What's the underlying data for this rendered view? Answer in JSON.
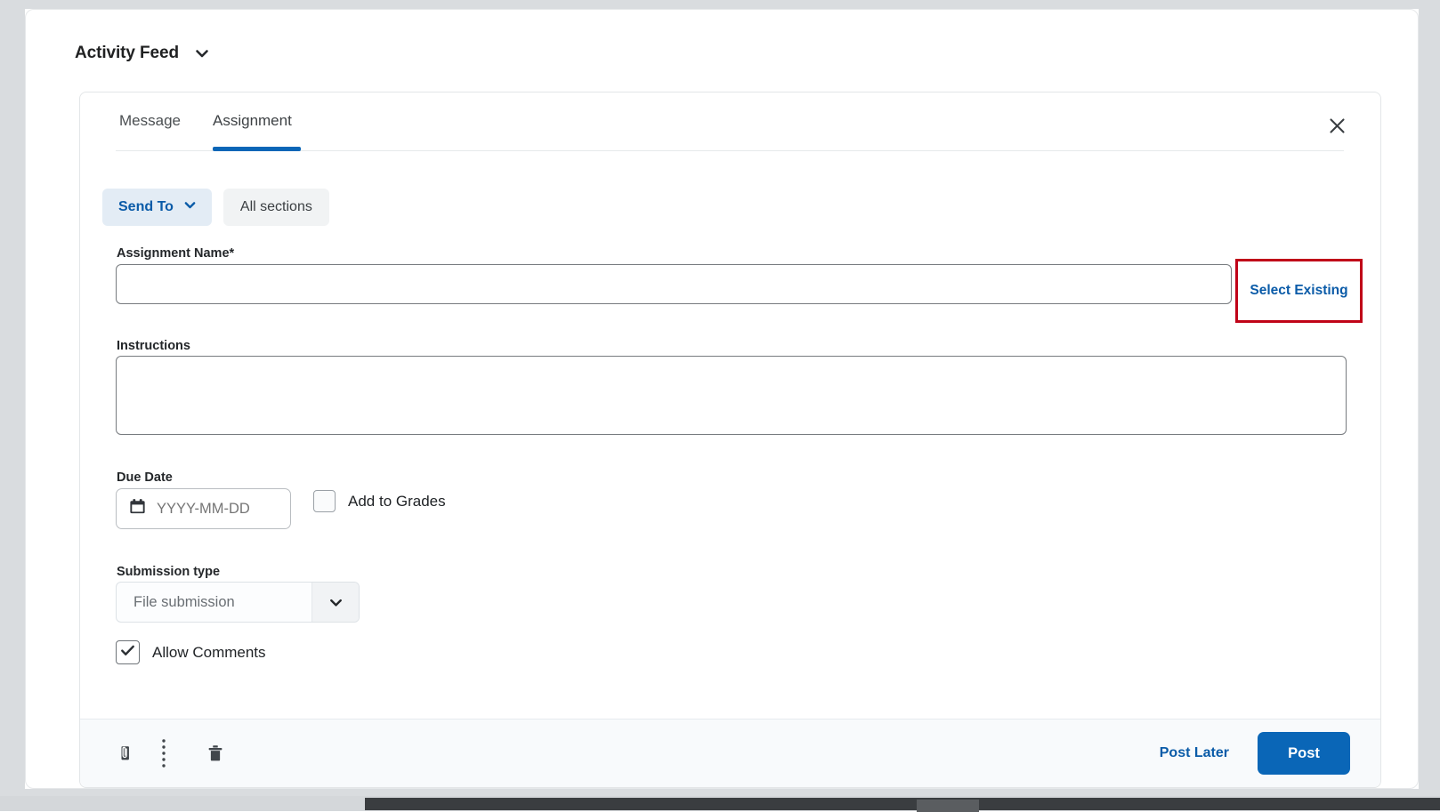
{
  "feed": {
    "title": "Activity Feed",
    "caret_icon": "chevron-down-icon"
  },
  "composer": {
    "tabs": [
      {
        "label": "Message",
        "active": false
      },
      {
        "label": "Assignment",
        "active": true
      }
    ],
    "close_icon": "close-icon",
    "send_to": {
      "label": "Send To",
      "caret_icon": "chevron-down-icon"
    },
    "all_sections_label": "All sections",
    "assignment_name": {
      "label": "Assignment Name",
      "required_marker": "*",
      "value": "",
      "placeholder": ""
    },
    "select_existing": {
      "label": "Select Existing",
      "highlight_color": "#c00418"
    },
    "instructions": {
      "label": "Instructions",
      "value": "",
      "placeholder": ""
    },
    "due_date": {
      "label": "Due Date",
      "calendar_icon": "calendar-icon",
      "value": "",
      "placeholder": "YYYY-MM-DD"
    },
    "add_to_grades": {
      "label": "Add to Grades",
      "checked": false
    },
    "submission_type": {
      "label": "Submission type",
      "selected": "File submission",
      "caret_icon": "chevron-down-icon"
    },
    "allow_comments": {
      "label": "Allow Comments",
      "checked": true,
      "check_icon": "check-icon"
    },
    "footer": {
      "attach_icon": "paperclip-icon",
      "more_icon": "kebab-menu-icon",
      "delete_icon": "trash-icon",
      "post_later_label": "Post Later",
      "post_label": "Post",
      "primary_color": "#0a66b7"
    }
  }
}
